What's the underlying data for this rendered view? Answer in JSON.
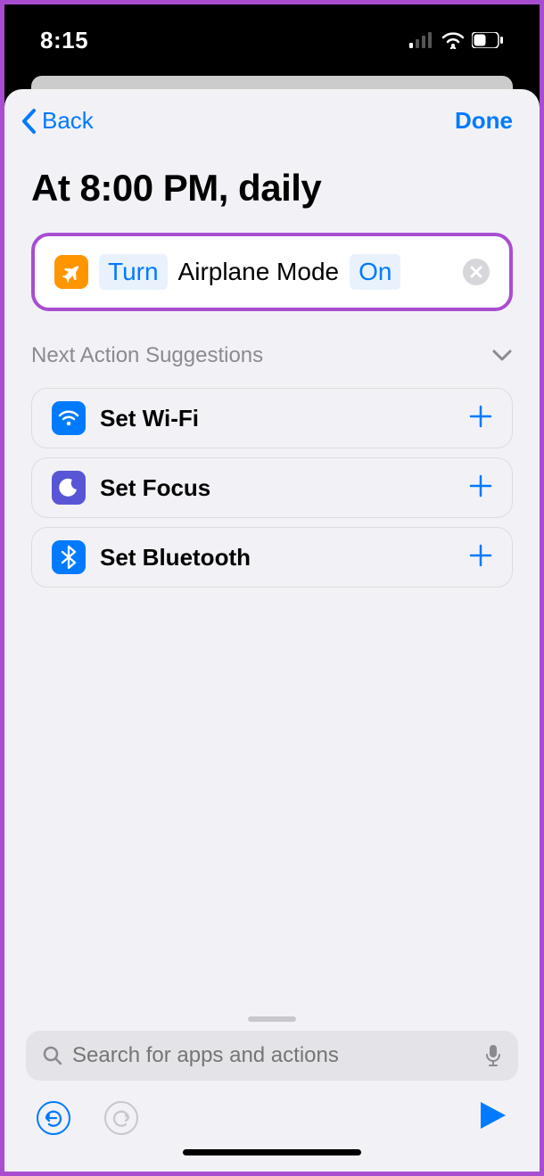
{
  "status": {
    "time": "8:15"
  },
  "nav": {
    "back": "Back",
    "done": "Done"
  },
  "title": "At 8:00 PM, daily",
  "action": {
    "turn": "Turn",
    "mode": "Airplane Mode",
    "state": "On"
  },
  "suggestions_header": "Next Action Suggestions",
  "suggestions": [
    {
      "label": "Set Wi-Fi",
      "icon": "wifi"
    },
    {
      "label": "Set Focus",
      "icon": "focus"
    },
    {
      "label": "Set Bluetooth",
      "icon": "bluetooth"
    }
  ],
  "search": {
    "placeholder": "Search for apps and actions"
  }
}
